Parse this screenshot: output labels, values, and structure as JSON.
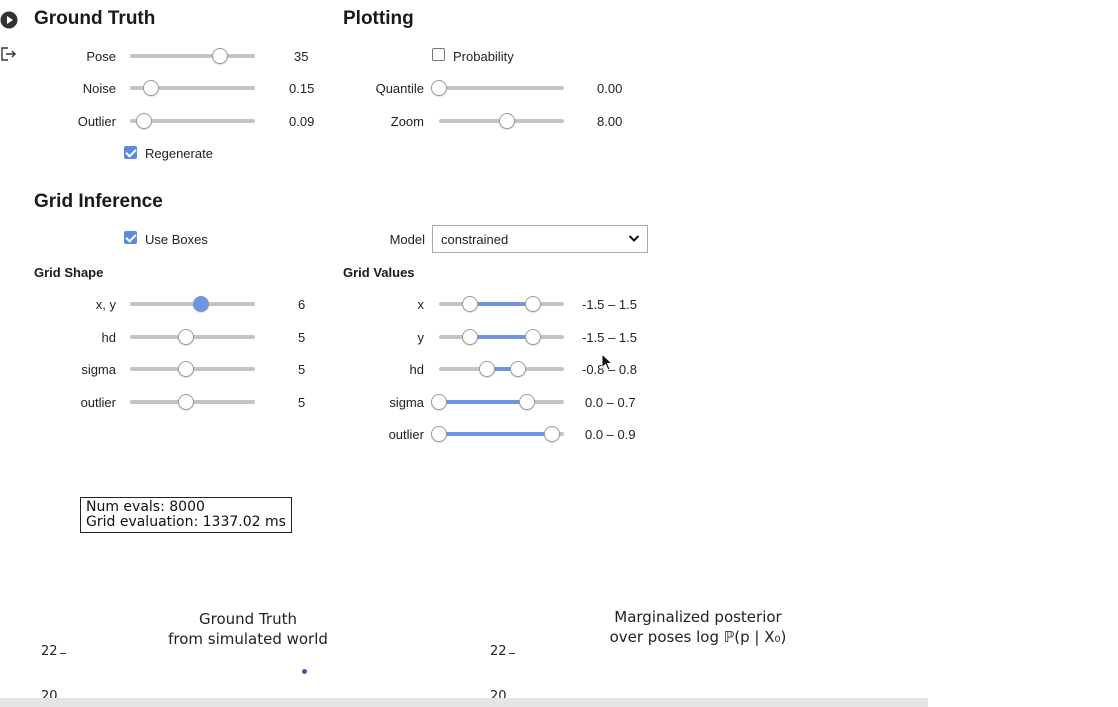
{
  "side_icons": [
    "play-circle-icon",
    "exit-icon"
  ],
  "ground_truth": {
    "title": "Ground Truth",
    "sliders": [
      {
        "label": "Pose",
        "value": "35",
        "fraction": 0.72
      },
      {
        "label": "Noise",
        "value": "0.15",
        "fraction": 0.17
      },
      {
        "label": "Outlier",
        "value": "0.09",
        "fraction": 0.11
      }
    ],
    "regenerate": {
      "label": "Regenerate",
      "checked": true
    }
  },
  "plotting": {
    "title": "Plotting",
    "probability": {
      "label": "Probability",
      "checked": false
    },
    "sliders": [
      {
        "label": "Quantile",
        "value": "0.00",
        "fraction": 0.0
      },
      {
        "label": "Zoom",
        "value": "8.00",
        "fraction": 0.54
      }
    ]
  },
  "grid_inference": {
    "title": "Grid Inference",
    "use_boxes": {
      "label": "Use Boxes",
      "checked": true
    },
    "model": {
      "label": "Model",
      "selected": "constrained"
    },
    "grid_shape": {
      "title": "Grid Shape",
      "sliders": [
        {
          "label": "x, y",
          "value": "6",
          "fraction": 0.57,
          "active": true
        },
        {
          "label": "hd",
          "value": "5",
          "fraction": 0.45
        },
        {
          "label": "sigma",
          "value": "5",
          "fraction": 0.45
        },
        {
          "label": "outlier",
          "value": "5",
          "fraction": 0.45
        }
      ]
    },
    "grid_values": {
      "title": "Grid Values",
      "sliders": [
        {
          "label": "x",
          "value": "-1.5 – 1.5",
          "low": 0.25,
          "high": 0.75
        },
        {
          "label": "y",
          "value": "-1.5 – 1.5",
          "low": 0.25,
          "high": 0.75
        },
        {
          "label": "hd",
          "value": "-0.8 – 0.8",
          "low": 0.38,
          "high": 0.63
        },
        {
          "label": "sigma",
          "value": "0.0 – 0.7",
          "low": 0.0,
          "high": 0.7
        },
        {
          "label": "outlier",
          "value": "0.0 – 0.9",
          "low": 0.0,
          "high": 0.9
        }
      ]
    }
  },
  "eval_box": {
    "line1": "Num evals: 8000",
    "line2": "Grid evaluation: 1337.02 ms"
  },
  "plots": {
    "left": {
      "title_line1": "Ground Truth",
      "title_line2": "from simulated world",
      "ticks": [
        "22",
        "20"
      ]
    },
    "right": {
      "title_line1": "Marginalized posterior",
      "title_line2": "over poses log ℙ(p | X₀)",
      "ticks": [
        "22",
        "20"
      ]
    }
  },
  "colors": {
    "accent": "#6e95dd",
    "track": "#c4c4c4",
    "checkbox": "#5b8be0"
  }
}
